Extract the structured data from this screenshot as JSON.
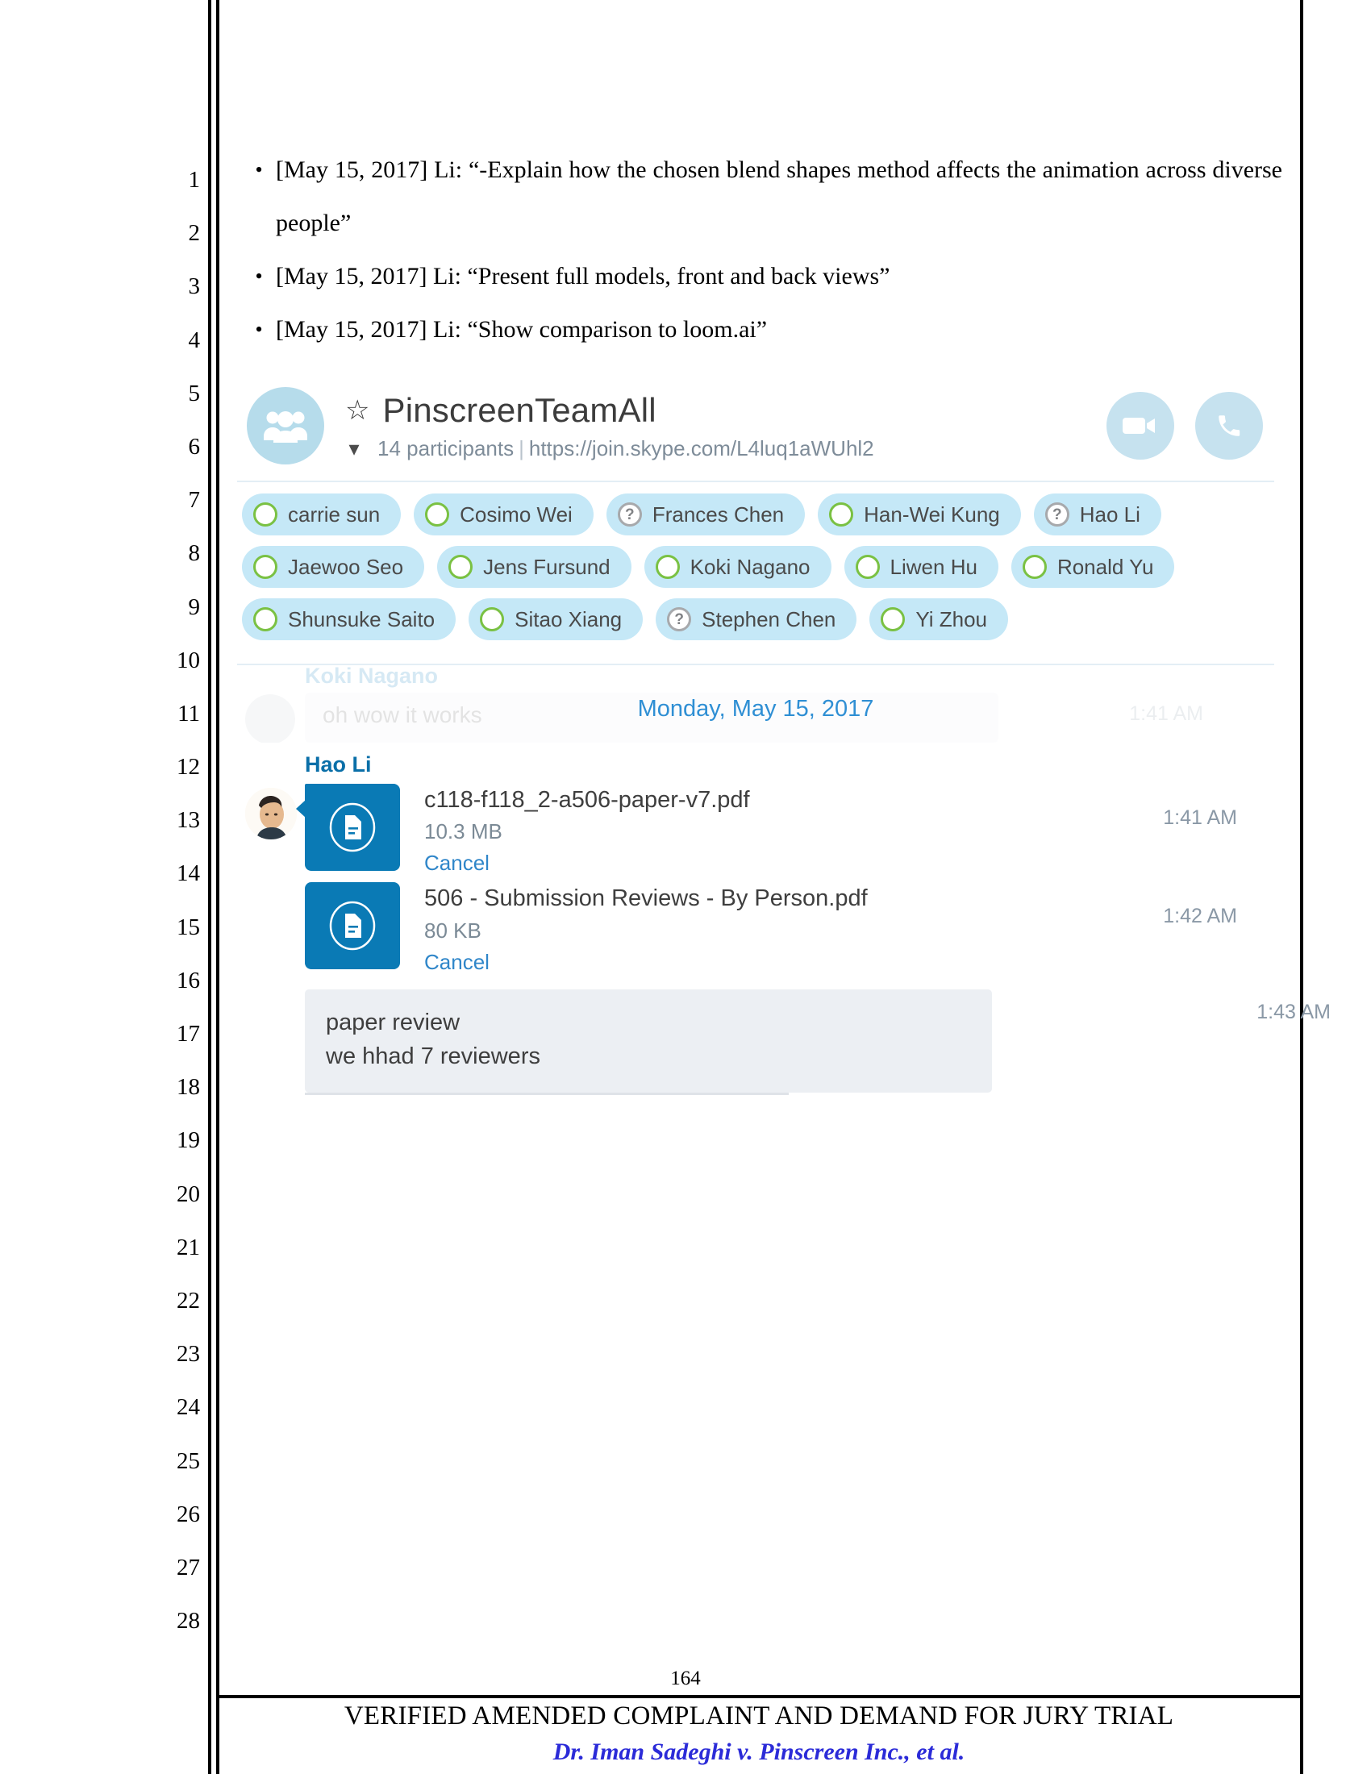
{
  "document": {
    "line_numbers": [
      "1",
      "2",
      "3",
      "4",
      "5",
      "6",
      "7",
      "8",
      "9",
      "10",
      "11",
      "12",
      "13",
      "14",
      "15",
      "16",
      "17",
      "18",
      "19",
      "20",
      "21",
      "22",
      "23",
      "24",
      "25",
      "26",
      "27",
      "28"
    ],
    "bullets": [
      {
        "marker": "•",
        "text": "[May 15, 2017] Li: “-Explain how the chosen blend shapes method affects the animation across diverse people”"
      },
      {
        "marker": "•",
        "text": "[May 15, 2017] Li: “Present full models, front and back views”"
      },
      {
        "marker": "•",
        "text": "[May 15, 2017] Li: “Show comparison to loom.ai”"
      }
    ],
    "footer": {
      "page_number": "164",
      "title": "VERIFIED AMENDED COMPLAINT AND DEMAND FOR JURY TRIAL",
      "case_caption": "Dr. Iman Sadeghi v. Pinscreen Inc., et al.",
      "case_caption_color": "#2b2bd8"
    }
  },
  "skype": {
    "header": {
      "group_avatar_icon": "people-group-icon",
      "favorite_icon": "star-icon",
      "title": "PinscreenTeamAll",
      "expand_icon": "chevron-down-icon",
      "participant_count": "14 participants",
      "separator": "|",
      "join_url": "https://join.skype.com/L4luq1aWUhl2",
      "video_call_icon": "video-camera-icon",
      "audio_call_icon": "phone-icon",
      "action_button_color": "#c6e2ef"
    },
    "participants": {
      "chip_bg_color": "#c5e8f7",
      "online_color": "#7ac143",
      "unknown_color": "#a7a9ac",
      "rows": [
        [
          {
            "name": "carrie sun",
            "status": "online"
          },
          {
            "name": "Cosimo Wei",
            "status": "online"
          },
          {
            "name": "Frances Chen",
            "status": "unknown"
          },
          {
            "name": "Han-Wei Kung",
            "status": "online"
          },
          {
            "name": "Hao Li",
            "status": "unknown"
          }
        ],
        [
          {
            "name": "Jaewoo Seo",
            "status": "online"
          },
          {
            "name": "Jens Fursund",
            "status": "online"
          },
          {
            "name": "Koki Nagano",
            "status": "online"
          },
          {
            "name": "Liwen Hu",
            "status": "online"
          },
          {
            "name": "Ronald Yu",
            "status": "online"
          }
        ],
        [
          {
            "name": "Shunsuke Saito",
            "status": "online"
          },
          {
            "name": "Sitao Xiang",
            "status": "online"
          },
          {
            "name": "Stephen Chen",
            "status": "unknown"
          },
          {
            "name": "Yi Zhou",
            "status": "online"
          }
        ]
      ]
    },
    "chat": {
      "date_divider": "Monday, May 15, 2017",
      "faded_message": {
        "sender": "Koki Nagano",
        "text": "oh wow it works",
        "time": "1:41 AM"
      },
      "message": {
        "sender": "Hao Li",
        "sender_color": "#0a6fa8",
        "attachments": [
          {
            "file_icon": "document-file-icon",
            "filename": "c118-f118_2-a506-paper-v7.pdf",
            "size": "10.3 MB",
            "action": "Cancel",
            "time": "1:41 AM"
          },
          {
            "file_icon": "document-file-icon",
            "filename": "506 - Submission Reviews - By Person.pdf",
            "size": "80 KB",
            "action": "Cancel",
            "time": "1:42 AM"
          }
        ],
        "text_bubble": {
          "lines": [
            "paper review",
            "we hhad 7 reviewers"
          ],
          "time": "1:43 AM"
        }
      }
    }
  }
}
